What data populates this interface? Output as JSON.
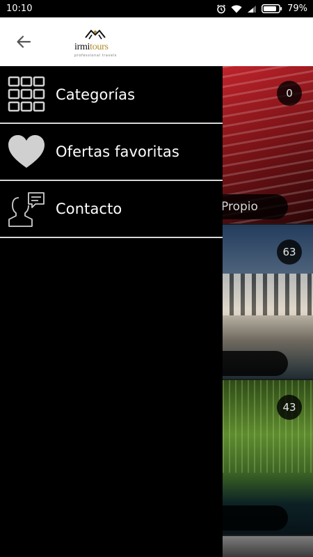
{
  "status_bar": {
    "time": "10:10",
    "battery": "79%",
    "icons": [
      "alarm-icon",
      "wifi-icon",
      "signal-icon",
      "battery-icon"
    ]
  },
  "toolbar": {
    "back_icon": "arrow-left-icon",
    "logo": {
      "word_main": "irmi",
      "word_accent": "tours",
      "tagline": "professional travels"
    }
  },
  "drawer": {
    "items": [
      {
        "label": "Categorías",
        "icon": "grid-icon"
      },
      {
        "label": "Ofertas favoritas",
        "icon": "heart-icon"
      },
      {
        "label": "Contacto",
        "icon": "contact-chat-icon"
      }
    ]
  },
  "content": {
    "cards": [
      {
        "count": "0",
        "label": "Propio"
      },
      {
        "count": "63",
        "label": ""
      },
      {
        "count": "43",
        "label": ""
      }
    ]
  },
  "colors": {
    "drawer_bg": "#000000",
    "toolbar_bg": "#ffffff",
    "divider": "#d8d8d8",
    "icon_gray": "#d0d0d0",
    "logo_accent": "#b08a2e"
  }
}
